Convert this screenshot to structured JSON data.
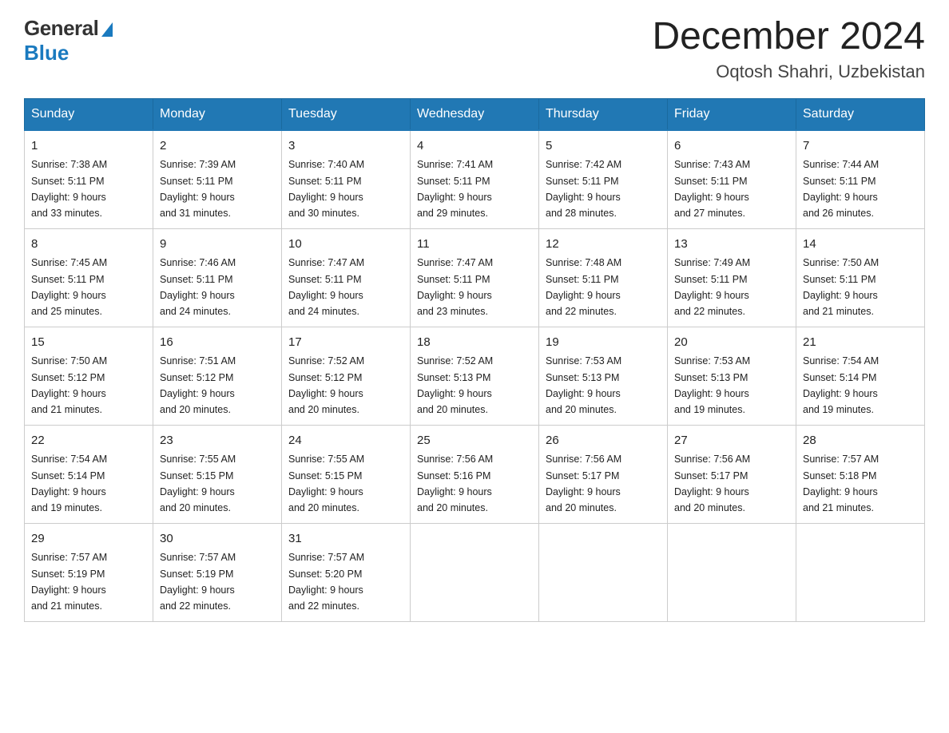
{
  "header": {
    "logo_line1": "General",
    "logo_line2": "Blue",
    "title": "December 2024",
    "subtitle": "Oqtosh Shahri, Uzbekistan"
  },
  "days_of_week": [
    "Sunday",
    "Monday",
    "Tuesday",
    "Wednesday",
    "Thursday",
    "Friday",
    "Saturday"
  ],
  "weeks": [
    [
      {
        "day": "1",
        "sunrise": "7:38 AM",
        "sunset": "5:11 PM",
        "daylight": "9 hours and 33 minutes."
      },
      {
        "day": "2",
        "sunrise": "7:39 AM",
        "sunset": "5:11 PM",
        "daylight": "9 hours and 31 minutes."
      },
      {
        "day": "3",
        "sunrise": "7:40 AM",
        "sunset": "5:11 PM",
        "daylight": "9 hours and 30 minutes."
      },
      {
        "day": "4",
        "sunrise": "7:41 AM",
        "sunset": "5:11 PM",
        "daylight": "9 hours and 29 minutes."
      },
      {
        "day": "5",
        "sunrise": "7:42 AM",
        "sunset": "5:11 PM",
        "daylight": "9 hours and 28 minutes."
      },
      {
        "day": "6",
        "sunrise": "7:43 AM",
        "sunset": "5:11 PM",
        "daylight": "9 hours and 27 minutes."
      },
      {
        "day": "7",
        "sunrise": "7:44 AM",
        "sunset": "5:11 PM",
        "daylight": "9 hours and 26 minutes."
      }
    ],
    [
      {
        "day": "8",
        "sunrise": "7:45 AM",
        "sunset": "5:11 PM",
        "daylight": "9 hours and 25 minutes."
      },
      {
        "day": "9",
        "sunrise": "7:46 AM",
        "sunset": "5:11 PM",
        "daylight": "9 hours and 24 minutes."
      },
      {
        "day": "10",
        "sunrise": "7:47 AM",
        "sunset": "5:11 PM",
        "daylight": "9 hours and 24 minutes."
      },
      {
        "day": "11",
        "sunrise": "7:47 AM",
        "sunset": "5:11 PM",
        "daylight": "9 hours and 23 minutes."
      },
      {
        "day": "12",
        "sunrise": "7:48 AM",
        "sunset": "5:11 PM",
        "daylight": "9 hours and 22 minutes."
      },
      {
        "day": "13",
        "sunrise": "7:49 AM",
        "sunset": "5:11 PM",
        "daylight": "9 hours and 22 minutes."
      },
      {
        "day": "14",
        "sunrise": "7:50 AM",
        "sunset": "5:11 PM",
        "daylight": "9 hours and 21 minutes."
      }
    ],
    [
      {
        "day": "15",
        "sunrise": "7:50 AM",
        "sunset": "5:12 PM",
        "daylight": "9 hours and 21 minutes."
      },
      {
        "day": "16",
        "sunrise": "7:51 AM",
        "sunset": "5:12 PM",
        "daylight": "9 hours and 20 minutes."
      },
      {
        "day": "17",
        "sunrise": "7:52 AM",
        "sunset": "5:12 PM",
        "daylight": "9 hours and 20 minutes."
      },
      {
        "day": "18",
        "sunrise": "7:52 AM",
        "sunset": "5:13 PM",
        "daylight": "9 hours and 20 minutes."
      },
      {
        "day": "19",
        "sunrise": "7:53 AM",
        "sunset": "5:13 PM",
        "daylight": "9 hours and 20 minutes."
      },
      {
        "day": "20",
        "sunrise": "7:53 AM",
        "sunset": "5:13 PM",
        "daylight": "9 hours and 19 minutes."
      },
      {
        "day": "21",
        "sunrise": "7:54 AM",
        "sunset": "5:14 PM",
        "daylight": "9 hours and 19 minutes."
      }
    ],
    [
      {
        "day": "22",
        "sunrise": "7:54 AM",
        "sunset": "5:14 PM",
        "daylight": "9 hours and 19 minutes."
      },
      {
        "day": "23",
        "sunrise": "7:55 AM",
        "sunset": "5:15 PM",
        "daylight": "9 hours and 20 minutes."
      },
      {
        "day": "24",
        "sunrise": "7:55 AM",
        "sunset": "5:15 PM",
        "daylight": "9 hours and 20 minutes."
      },
      {
        "day": "25",
        "sunrise": "7:56 AM",
        "sunset": "5:16 PM",
        "daylight": "9 hours and 20 minutes."
      },
      {
        "day": "26",
        "sunrise": "7:56 AM",
        "sunset": "5:17 PM",
        "daylight": "9 hours and 20 minutes."
      },
      {
        "day": "27",
        "sunrise": "7:56 AM",
        "sunset": "5:17 PM",
        "daylight": "9 hours and 20 minutes."
      },
      {
        "day": "28",
        "sunrise": "7:57 AM",
        "sunset": "5:18 PM",
        "daylight": "9 hours and 21 minutes."
      }
    ],
    [
      {
        "day": "29",
        "sunrise": "7:57 AM",
        "sunset": "5:19 PM",
        "daylight": "9 hours and 21 minutes."
      },
      {
        "day": "30",
        "sunrise": "7:57 AM",
        "sunset": "5:19 PM",
        "daylight": "9 hours and 22 minutes."
      },
      {
        "day": "31",
        "sunrise": "7:57 AM",
        "sunset": "5:20 PM",
        "daylight": "9 hours and 22 minutes."
      },
      null,
      null,
      null,
      null
    ]
  ],
  "labels": {
    "sunrise": "Sunrise: ",
    "sunset": "Sunset: ",
    "daylight": "Daylight: "
  }
}
